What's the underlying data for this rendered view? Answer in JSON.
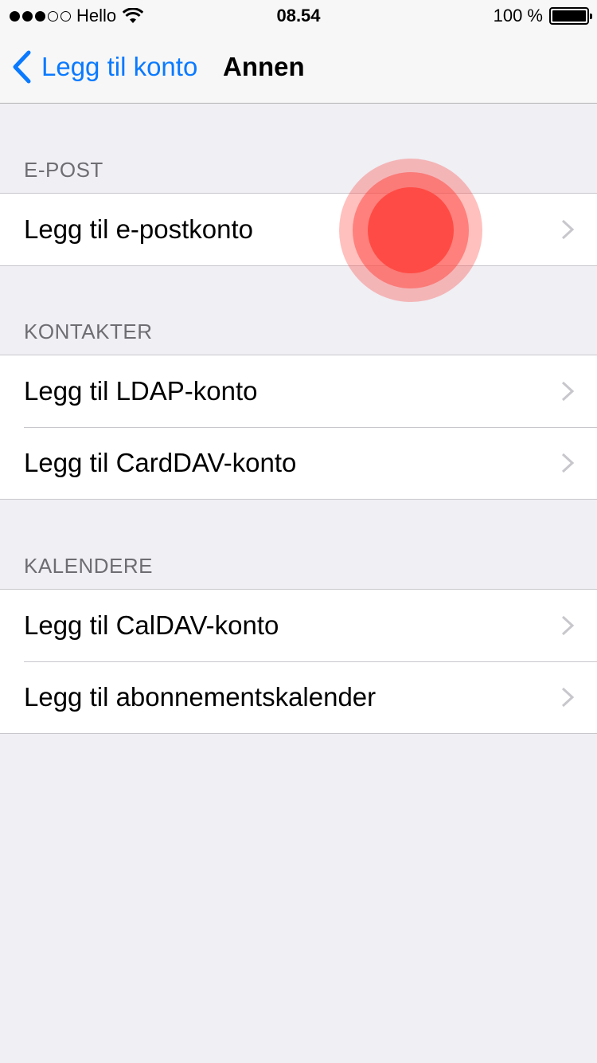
{
  "status_bar": {
    "carrier": "Hello",
    "time": "08.54",
    "battery": "100 %",
    "signal_bars_filled": 3,
    "signal_bars_total": 5
  },
  "nav": {
    "back_label": "Legg til konto",
    "title": "Annen"
  },
  "sections": [
    {
      "header": "E-POST",
      "rows": [
        "Legg til e-postkonto"
      ]
    },
    {
      "header": "KONTAKTER",
      "rows": [
        "Legg til LDAP-konto",
        "Legg til CardDAV-konto"
      ]
    },
    {
      "header": "KALENDERE",
      "rows": [
        "Legg til CalDAV-konto",
        "Legg til abonnementskalender"
      ]
    }
  ],
  "colors": {
    "accent": "#0a7aff",
    "background": "#efeff4",
    "touch_indicator": "#ff4b45"
  },
  "icons": [
    "wifi-icon",
    "battery-icon",
    "back-chevron-icon",
    "disclosure-chevron-icon"
  ]
}
